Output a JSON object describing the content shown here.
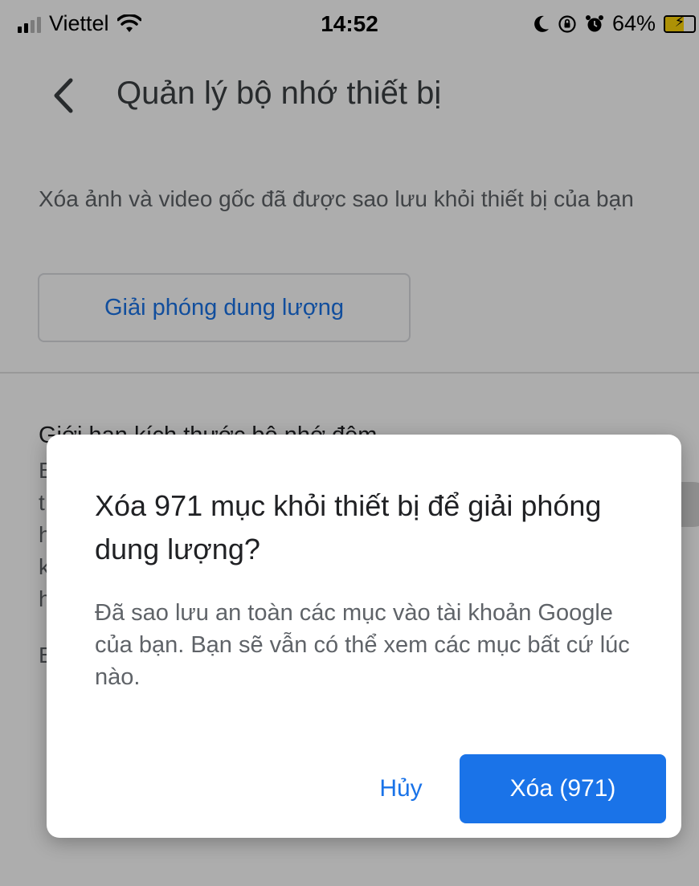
{
  "status_bar": {
    "carrier": "Viettel",
    "time": "14:52",
    "battery_percent": "64%",
    "battery_level": 0.64,
    "icons": [
      "signal-icon",
      "wifi-icon",
      "moon-icon",
      "rotation-lock-icon",
      "alarm-icon",
      "battery-charging-icon"
    ]
  },
  "header": {
    "title": "Quản lý bộ nhớ thiết bị"
  },
  "free_up_section": {
    "description": "Xóa ảnh và video gốc đã được sao lưu khỏi thiết bị của bạn",
    "button_label": "Giải phóng dung lượng"
  },
  "cache_section": {
    "title": "Giới hạn kích thước bộ nhớ đệm",
    "line_initials": [
      "B",
      "t",
      "h",
      "k",
      "h"
    ],
    "extra_initial": "B"
  },
  "dialog": {
    "title": "Xóa 971 mục khỏi thiết bị để giải phóng dung lượng?",
    "body": "Đã sao lưu an toàn các mục vào tài khoản Google của bạn. Bạn sẽ vẫn có thể xem các mục bất cứ lúc nào.",
    "cancel_label": "Hủy",
    "delete_label": "Xóa (971)"
  },
  "colors": {
    "accent": "#1a73e8",
    "scrim": "rgba(0,0,0,0.32)",
    "battery_fill": "#ffd60a"
  }
}
